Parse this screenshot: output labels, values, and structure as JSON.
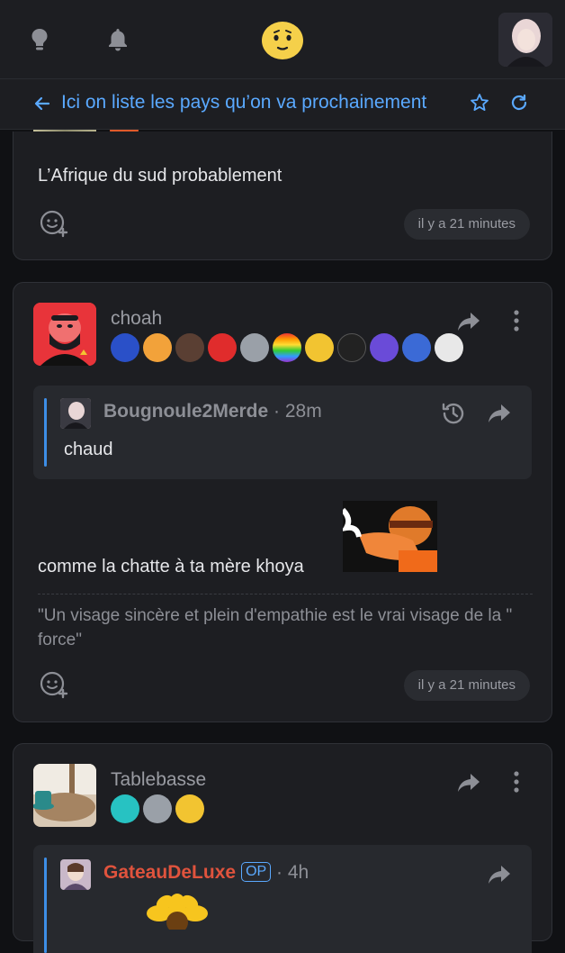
{
  "header": {
    "icons": [
      "lightbulb-icon",
      "bell-icon",
      "smiley-logo-icon"
    ],
    "accent": "#5aa9ff"
  },
  "topic": {
    "title": "Ici on liste les pays qu’on va prochainement"
  },
  "posts": [
    {
      "text": "L’Afrique du sud probablement",
      "time": "il y a 21 minutes"
    },
    {
      "author": "choah",
      "quote": {
        "author": "Bougnoule2Merde",
        "separator": "·",
        "age": "28m",
        "text": "chaud"
      },
      "text": "comme la chatte à ta mère khoya",
      "signature": "\"Un visage sincère et plein d'empathie est le vrai visage de la \" force\"",
      "time": "il y a 21 minutes"
    },
    {
      "author": "Tablebasse",
      "quote": {
        "author": "GateauDeLuxe",
        "op_label": "OP",
        "separator": "·",
        "age": "4h"
      }
    }
  ]
}
